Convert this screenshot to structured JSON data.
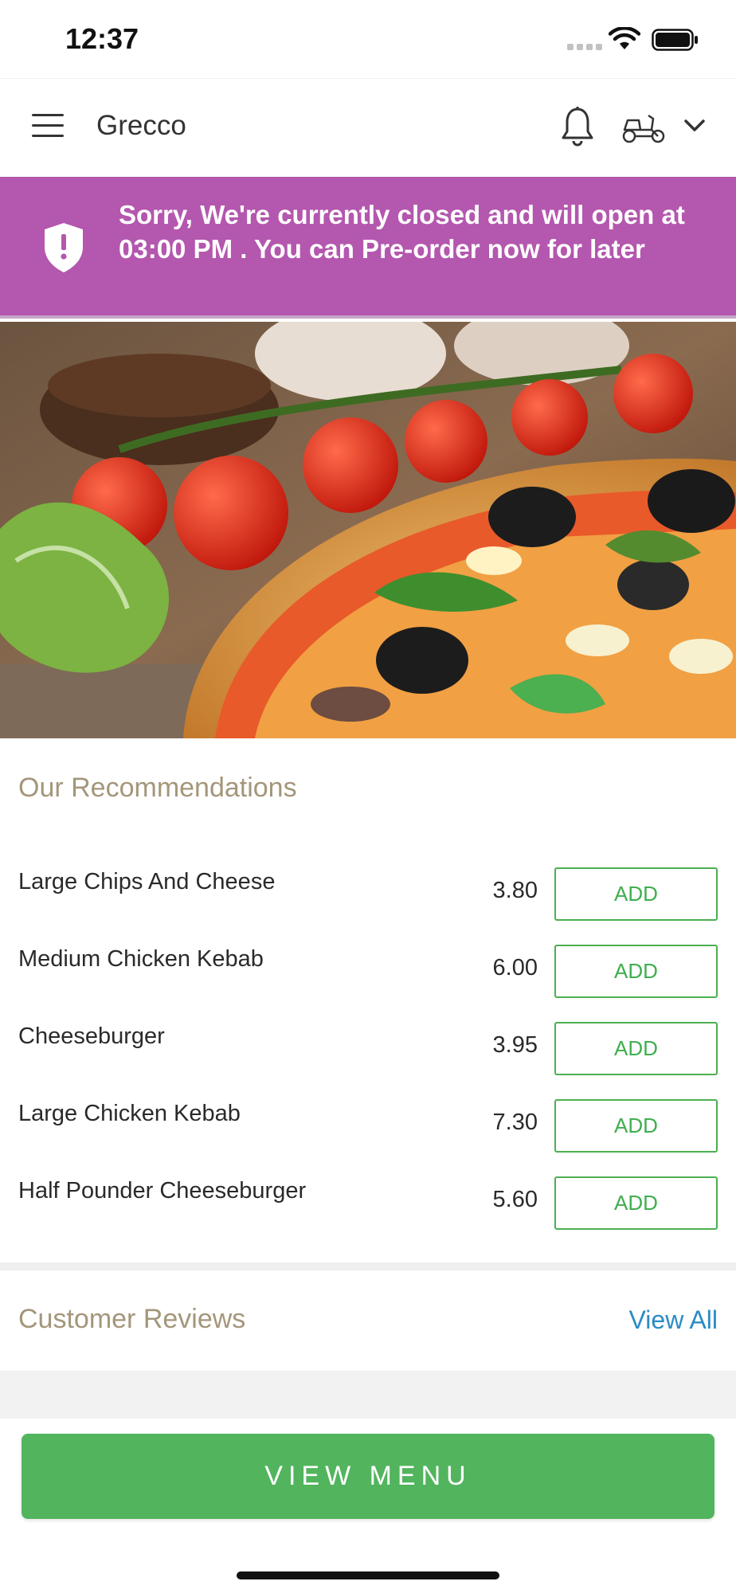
{
  "status_bar": {
    "time": "12:37"
  },
  "header": {
    "title": "Grecco",
    "icons": [
      "menu-icon",
      "bell-icon",
      "delivery-scooter-icon",
      "chevron-down-icon"
    ]
  },
  "closed_banner": {
    "icon": "shield-alert-icon",
    "message": "Sorry, We're currently closed and will open at 03:00 PM . You can Pre-order now for later",
    "background": "#b457ae"
  },
  "recommendations": {
    "title": "Our Recommendations",
    "items": [
      {
        "name": "Large Chips And Cheese",
        "price": "3.80",
        "action": "ADD"
      },
      {
        "name": "Medium Chicken Kebab",
        "price": "6.00",
        "action": "ADD"
      },
      {
        "name": "Cheeseburger",
        "price": "3.95",
        "action": "ADD"
      },
      {
        "name": "Large Chicken Kebab",
        "price": "7.30",
        "action": "ADD"
      },
      {
        "name": "Half Pounder Cheeseburger",
        "price": "5.60",
        "action": "ADD"
      }
    ]
  },
  "reviews": {
    "title": "Customer Reviews",
    "view_all": "View All"
  },
  "footer": {
    "view_menu": "VIEW MENU"
  },
  "colors": {
    "accent_green": "#52b45d",
    "banner_purple": "#b457ae",
    "section_title": "#a4967a",
    "link_blue": "#2b8cc4"
  }
}
